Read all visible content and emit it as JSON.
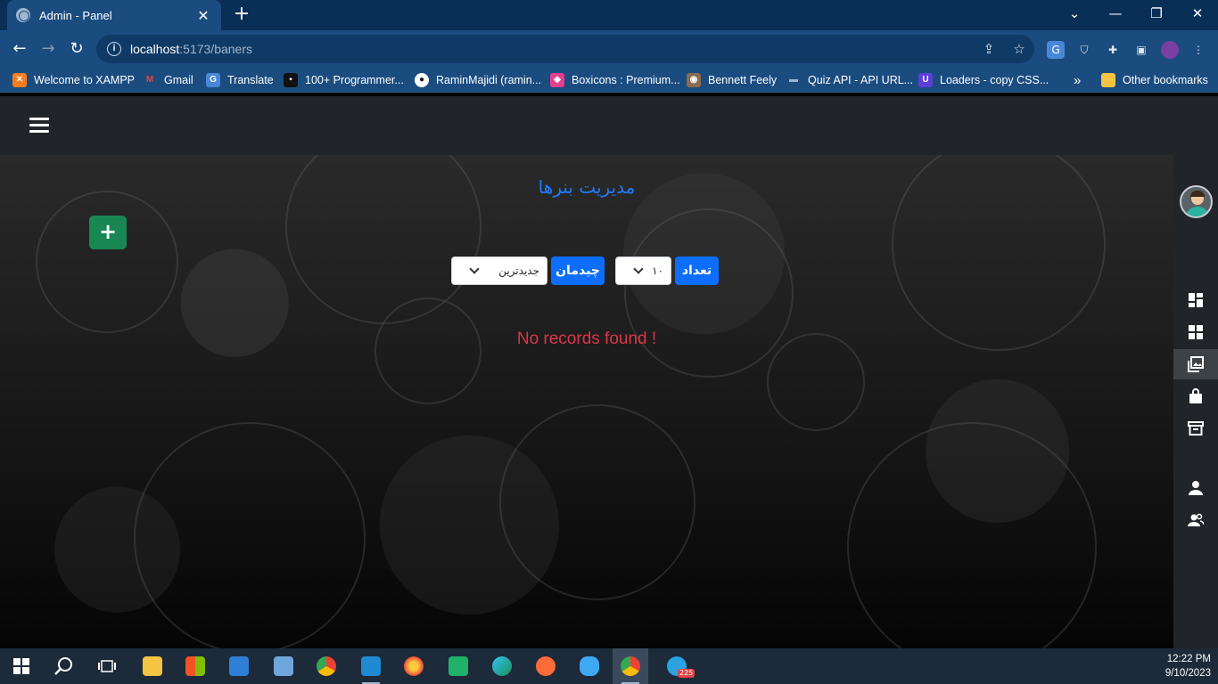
{
  "browser": {
    "tab_title": "Admin - Panel",
    "url_host": "localhost",
    "url_path": ":5173/baners",
    "bookmarks": [
      "Welcome to XAMPP",
      "Gmail",
      "Translate",
      "100+ Programmer...",
      "RaminMajidi (ramin...",
      "Boxicons : Premium...",
      "Bennett Feely",
      "Quiz API - API URL...",
      "Loaders - copy CSS..."
    ],
    "overflow": "»",
    "other_bookmarks": "Other bookmarks"
  },
  "page": {
    "title": "مدیریت بنرها",
    "add_button": "+",
    "count_label": "تعداد",
    "count_value": "۱۰",
    "sort_label": "چیدمان",
    "sort_value": "جدیدترین",
    "empty_message": "No records found !"
  },
  "taskbar": {
    "time": "12:22 PM",
    "date": "9/10/2023",
    "telegram_badge": "225"
  },
  "colors": {
    "accent": "#0d6efd",
    "add": "#198754",
    "error": "#dc3545",
    "chrome": "#1b4c80"
  }
}
